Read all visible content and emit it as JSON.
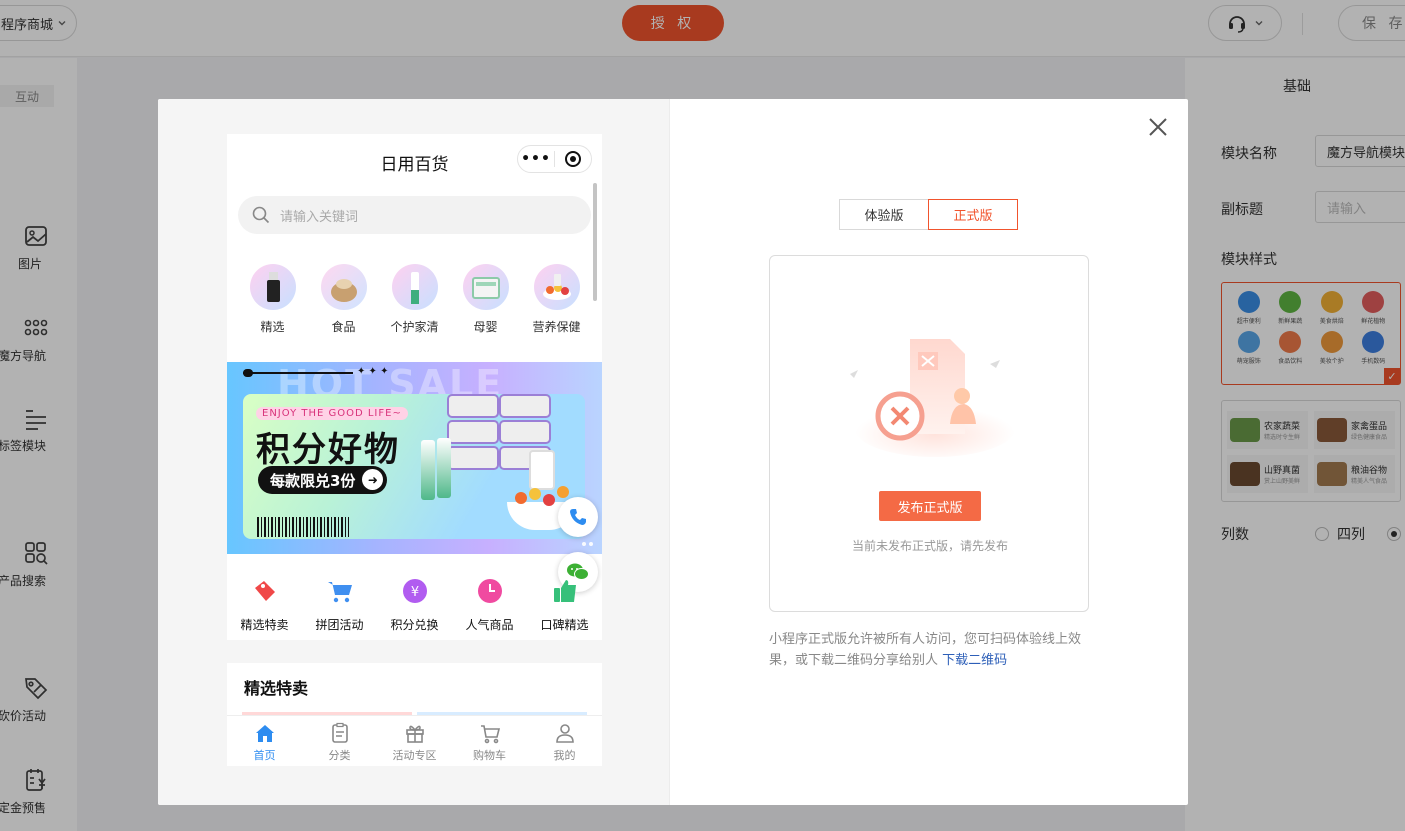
{
  "topbar": {
    "store_label": "程序商城",
    "auth_label": "授 权",
    "save_label": "保 存"
  },
  "leftbar": {
    "tab_label": "互动",
    "tools": [
      {
        "label": "图片",
        "icon": "image-icon"
      },
      {
        "label": "魔方导航",
        "icon": "grid-dots-icon"
      },
      {
        "label": "标签模块",
        "icon": "tag-list-icon"
      },
      {
        "label": "产品搜索",
        "icon": "product-search-icon"
      },
      {
        "label": "砍价活动",
        "icon": "bargain-tag-icon"
      },
      {
        "label": "定金预售",
        "icon": "deposit-presale-icon"
      }
    ]
  },
  "rightpanel": {
    "title": "基础",
    "module_name_label": "模块名称",
    "module_name_value": "魔方导航模块",
    "subtitle_label": "副标题",
    "subtitle_placeholder": "请输入",
    "style_label": "模块样式",
    "style1_items": [
      "超市便利",
      "新鲜果蔬",
      "美食烘焙",
      "鲜花植物",
      "萌宠服饰",
      "食品饮料",
      "美妆个护",
      "手机数码"
    ],
    "style2_items": [
      {
        "title": "农家蔬菜",
        "sub": "精选时令生鲜"
      },
      {
        "title": "家禽蛋品",
        "sub": "绿色健康食品"
      },
      {
        "title": "山野真菌",
        "sub": "赏上山野美鲜"
      },
      {
        "title": "粮油谷物",
        "sub": "精美人气食品"
      }
    ],
    "columns_label": "列数",
    "columns_option": "四列"
  },
  "phone": {
    "title": "日用百货",
    "search_placeholder": "请输入关键词",
    "categories": [
      "精选",
      "食品",
      "个护家清",
      "母婴",
      "营养保健"
    ],
    "banner": {
      "hot_text": "HOT SALE",
      "stars": "✦ ✦ ✦",
      "enjoy": "ENJOY THE GOOD LIFE~",
      "title": "积分好物",
      "pill": "每款限兑3份"
    },
    "nav_items": [
      "精选特卖",
      "拼团活动",
      "积分兑换",
      "人气商品",
      "口碑精选"
    ],
    "section_title": "精选特卖",
    "tabs": [
      "首页",
      "分类",
      "活动专区",
      "购物车",
      "我的"
    ]
  },
  "publish": {
    "tabs": [
      "体验版",
      "正式版"
    ],
    "active_tab": 1,
    "button_label": "发布正式版",
    "empty_tip": "当前未发布正式版，请先发布",
    "note": "小程序正式版允许被所有人访问，您可扫码体验线上效果，或下载二维码分享给别人",
    "download_link": "下载二维码"
  },
  "colors": {
    "accent": "#f1542d",
    "publish_button": "#f46a45",
    "link": "#2d5fb8",
    "tab_active": "#2d8cf0"
  }
}
